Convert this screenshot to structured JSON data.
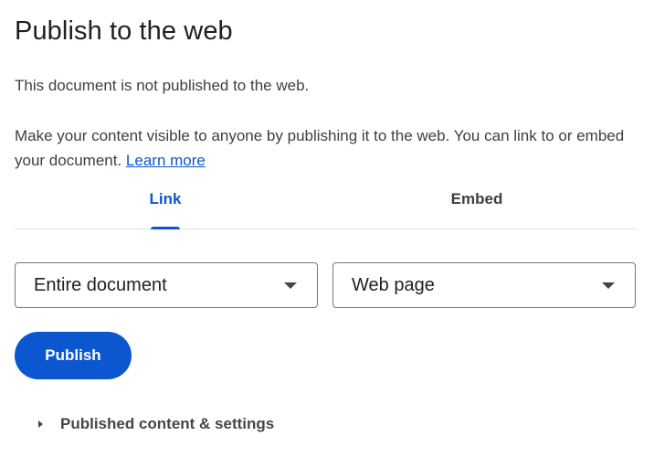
{
  "dialog": {
    "title": "Publish to the web",
    "status": "This document is not published to the web.",
    "description": "Make your content visible to anyone by publishing it to the web. You can link to or embed your document.",
    "learn_more": "Learn more"
  },
  "tabs": [
    {
      "label": "Link",
      "selected": true
    },
    {
      "label": "Embed",
      "selected": false
    }
  ],
  "scope_select": {
    "value": "Entire document",
    "icon": "dropdown-arrow-icon"
  },
  "format_select": {
    "value": "Web page",
    "icon": "dropdown-arrow-icon"
  },
  "publish_button": {
    "label": "Publish"
  },
  "settings_expander": {
    "label": "Published content & settings",
    "expanded": false,
    "icon": "caret-right-icon"
  },
  "colors": {
    "accent": "#0b57d0",
    "text": "#1f1f1f",
    "secondary_text": "#3c4043",
    "divider": "#e3e3e3",
    "outline": "#747775"
  }
}
